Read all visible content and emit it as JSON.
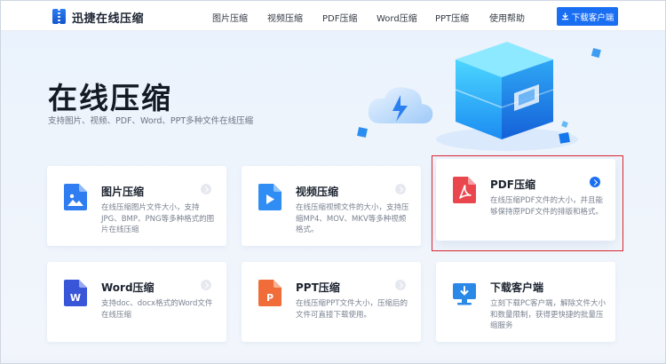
{
  "header": {
    "logo_text": "迅捷在线压缩",
    "nav": [
      {
        "label": "图片压缩"
      },
      {
        "label": "视频压缩"
      },
      {
        "label": "PDF压缩"
      },
      {
        "label": "Word压缩"
      },
      {
        "label": "PPT压缩"
      },
      {
        "label": "使用帮助"
      }
    ],
    "download_label": "下载客户端"
  },
  "hero": {
    "title": "在线压缩",
    "subtitle": "支持图片、视频、PDF、Word、PPT多种文件在线压缩"
  },
  "cards": [
    {
      "title": "图片压缩",
      "desc": "在线压缩图片文件大小，支持JPG、BMP、PNG等多种格式的图片在线压缩",
      "icon": "image-icon",
      "color": "#2f7df0"
    },
    {
      "title": "视频压缩",
      "desc": "在线压缩视频文件的大小，支持压缩MP4、MOV、MKV等多种视频格式。",
      "icon": "video-icon",
      "color": "#2f8df3"
    },
    {
      "title": "PDF压缩",
      "desc": "在线压缩PDF文件的大小，并且能够保持原PDF文件的排版和格式。",
      "icon": "pdf-icon",
      "color": "#e9464d"
    },
    {
      "title": "Word压缩",
      "desc": "支持doc、docx格式的Word文件在线压缩",
      "icon": "word-icon",
      "color": "#3a56d8"
    },
    {
      "title": "PPT压缩",
      "desc": "在线压缩PPT文件大小，压缩后的文件可直接下载使用。",
      "icon": "ppt-icon",
      "color": "#f06d3a"
    },
    {
      "title": "下载客户端",
      "desc": "立刻下载PC客户端，解除文件大小和数量限制，获得更快捷的批量压缩服务",
      "icon": "desktop-download-icon",
      "color": "#2a88e6"
    }
  ],
  "colors": {
    "accent": "#1a6ef2",
    "highlight": "#d9262f"
  }
}
